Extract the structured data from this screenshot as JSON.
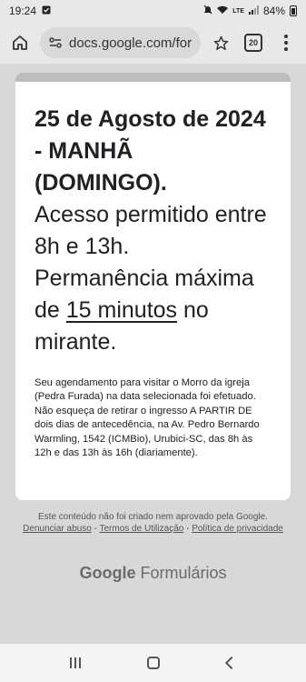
{
  "status_bar": {
    "time": "19:24",
    "battery": "84%",
    "network": "LTE"
  },
  "browser": {
    "url": "docs.google.com/for",
    "tab_count": "20"
  },
  "form": {
    "heading_bold": "25 de Agosto de 2024 - MANHÃ (DOMINGO).",
    "line_access": "Acesso permitido entre 8h e 13h.",
    "line_perm_a": "Permanência máxima de ",
    "line_perm_ul": "15 minutos",
    "line_perm_b": " no mirante.",
    "description": "Seu agendamento para visitar o Morro da igreja (Pedra Furada) na data selecionada foi efetuado. Não esqueça de retirar o ingresso A PARTIR DE dois dias de antecedência, na Av. Pedro Bernardo Warmling, 1542 (ICMBio), Urubici-SC, das 8h às 12h e das 13h às 16h (diariamente)."
  },
  "footer": {
    "disclaimer": "Este conteúdo não foi criado nem aprovado pela Google.",
    "link_abuse": "Denunciar abuso",
    "sep1": " - ",
    "link_terms": "Termos de Utilização",
    "sep2": " - ",
    "link_privacy": "Política de privacidade",
    "brand_google": "Google",
    "brand_product": "Formulários"
  }
}
